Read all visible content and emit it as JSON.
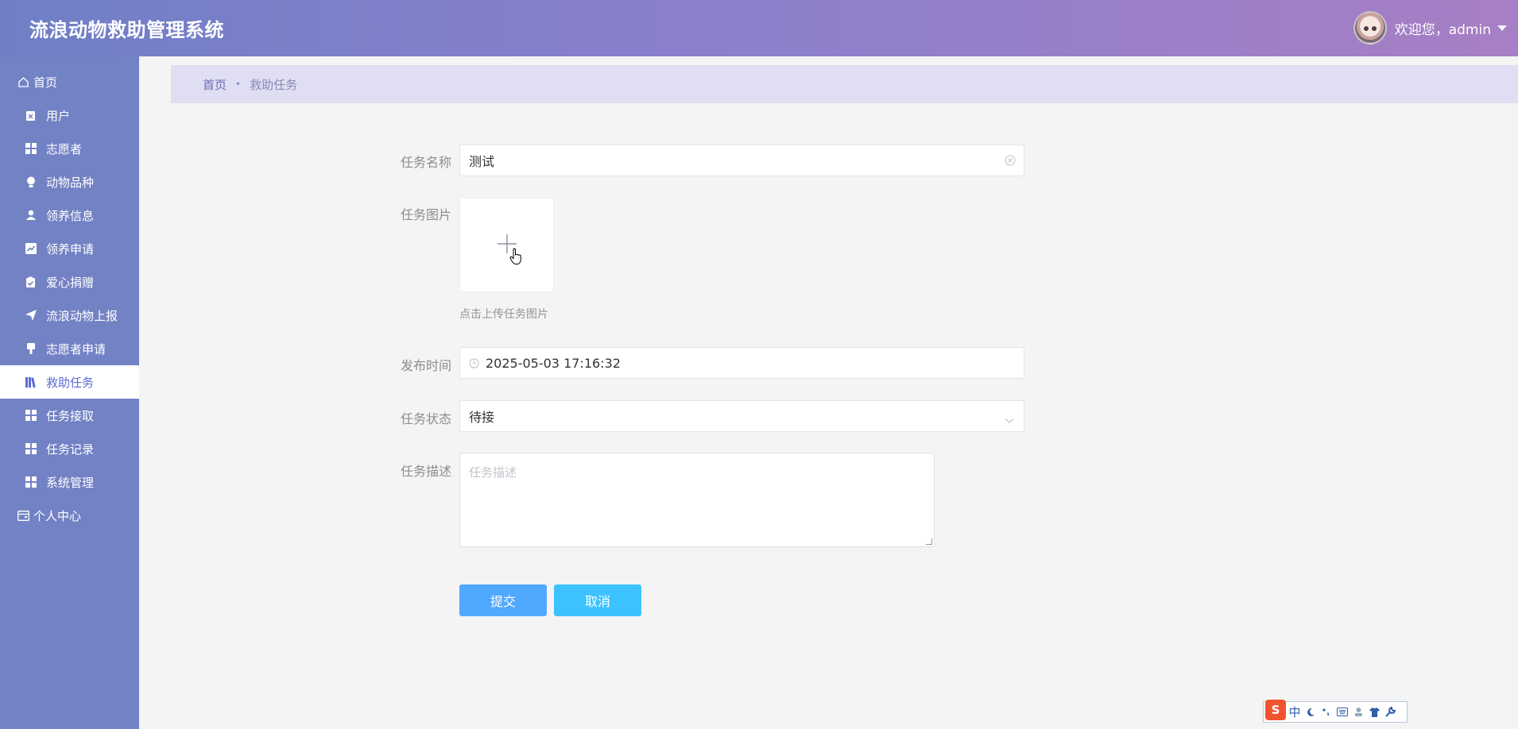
{
  "header": {
    "title": "流浪动物救助管理系统",
    "welcome": "欢迎您，admin"
  },
  "sidebar": {
    "items": [
      {
        "label": "首页",
        "icon": "home-icon"
      },
      {
        "label": "用户",
        "icon": "clipboard-icon"
      },
      {
        "label": "志愿者",
        "icon": "grid-icon"
      },
      {
        "label": "动物品种",
        "icon": "bulb-icon"
      },
      {
        "label": "领养信息",
        "icon": "person-icon"
      },
      {
        "label": "领养申请",
        "icon": "chart-icon"
      },
      {
        "label": "爱心捐赠",
        "icon": "check-clipboard-icon"
      },
      {
        "label": "流浪动物上报",
        "icon": "send-icon"
      },
      {
        "label": "志愿者申请",
        "icon": "brush-icon"
      },
      {
        "label": "救助任务",
        "icon": "books-icon"
      },
      {
        "label": "任务接取",
        "icon": "grid-icon"
      },
      {
        "label": "任务记录",
        "icon": "grid-icon"
      },
      {
        "label": "系统管理",
        "icon": "grid-icon"
      },
      {
        "label": "个人中心",
        "icon": "wallet-icon"
      }
    ],
    "active": "救助任务"
  },
  "breadcrumb": {
    "home": "首页",
    "sep": "•",
    "current": "救助任务"
  },
  "form": {
    "name_label": "任务名称",
    "name_value": "测试",
    "image_label": "任务图片",
    "image_tip": "点击上传任务图片",
    "time_label": "发布时间",
    "time_value": "2025-05-03 17:16:32",
    "status_label": "任务状态",
    "status_value": "待接",
    "desc_label": "任务描述",
    "desc_placeholder": "任务描述",
    "submit": "提交",
    "cancel": "取消"
  },
  "ime": {
    "logo": "S",
    "mode": "中"
  },
  "colors": {
    "header_start": "#6f7fc6",
    "header_end": "#a77fc4",
    "sidebar": "#7282c4",
    "active_text": "#5b6bd6",
    "submit": "#51a8ff",
    "cancel": "#3cc3ff"
  }
}
